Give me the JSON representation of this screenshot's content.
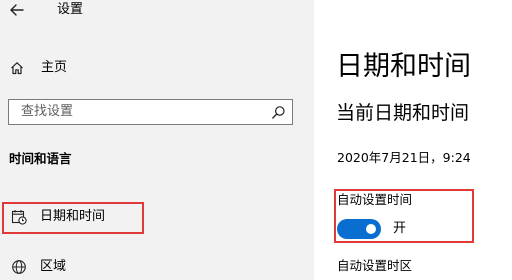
{
  "window": {
    "title": "设置"
  },
  "sidebar": {
    "home_label": "主页",
    "search_placeholder": "查找设置",
    "section_header": "时间和语言",
    "items": [
      {
        "label": "日期和时间",
        "icon": "calendar-clock-icon"
      },
      {
        "label": "区域",
        "icon": "globe-icon"
      }
    ]
  },
  "main": {
    "page_title": "日期和时间",
    "section_title": "当前日期和时间",
    "current_datetime": "2020年7月21日，9:24",
    "auto_time": {
      "label": "自动设置时间",
      "state_text": "开",
      "on": true
    },
    "auto_timezone": {
      "label": "自动设置时区"
    }
  },
  "colors": {
    "sidebar_bg": "#f2f2f2",
    "toggle_on": "#0a6ed1",
    "highlight": "#e03a3a"
  }
}
